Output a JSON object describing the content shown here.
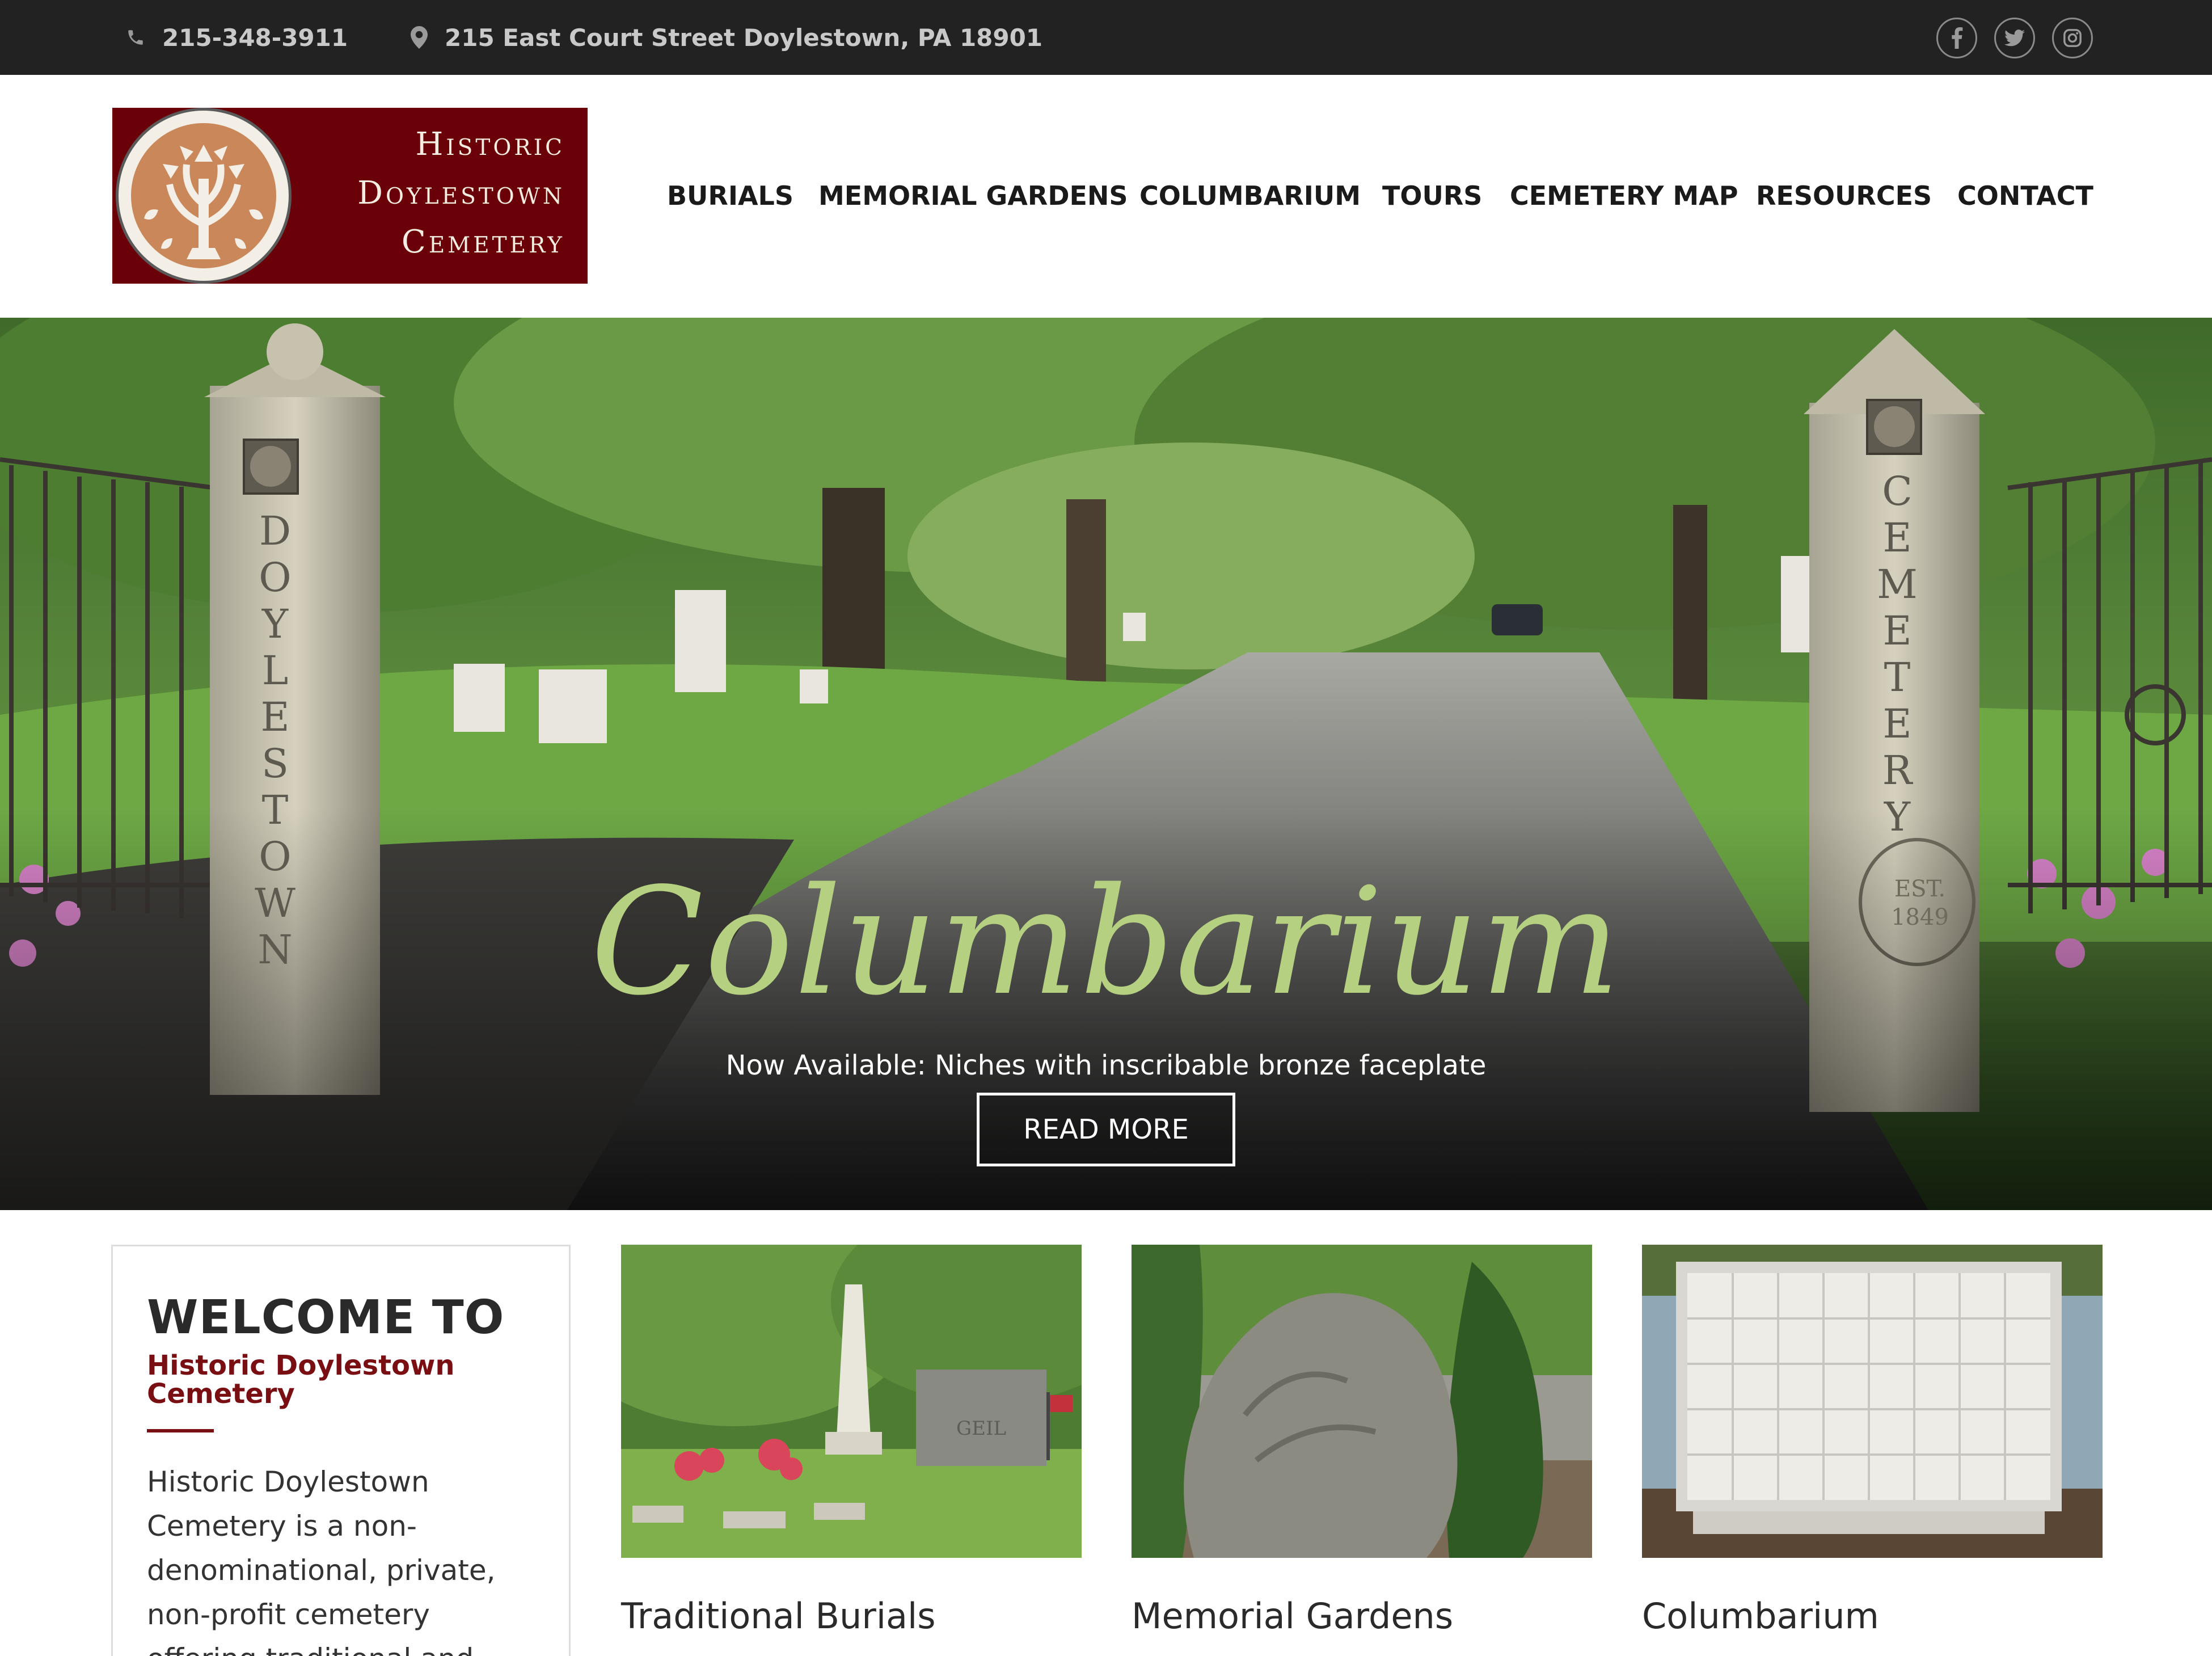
{
  "topbar": {
    "phone": "215-348-3911",
    "address": "215 East Court Street Doylestown, PA 18901",
    "social": [
      {
        "name": "facebook-icon",
        "glyph": "f"
      },
      {
        "name": "twitter-icon",
        "glyph": "t"
      },
      {
        "name": "instagram-icon",
        "glyph": "i"
      }
    ]
  },
  "logo": {
    "line1": "Historic",
    "line2": "Doylestown",
    "line3": "Cemetery",
    "colors": {
      "background": "#6a0008",
      "emblem": "#c9875a"
    }
  },
  "nav": {
    "items": [
      {
        "label": "BURIALS"
      },
      {
        "label": "MEMORIAL GARDENS"
      },
      {
        "label": "COLUMBARIUM"
      },
      {
        "label": "TOURS"
      },
      {
        "label": "CEMETERY MAP"
      },
      {
        "label": "RESOURCES"
      },
      {
        "label": "CONTACT"
      }
    ]
  },
  "hero": {
    "title": "Columbarium",
    "subtitle": "Now Available: Niches with inscribable bronze faceplate",
    "button": "READ MORE",
    "left_pillar_text": "DOYLESTOWN",
    "right_pillar_text": "CEMETERY",
    "est_line1": "EST.",
    "est_line2": "1849",
    "title_color": "#b5d080"
  },
  "welcome": {
    "title": "WELCOME TO",
    "subtitle": "Historic Doylestown Cemetery",
    "body": "Historic Doylestown Cemetery is a non-denominational, private, non-profit cemetery offering traditional and natural burial"
  },
  "cards": [
    {
      "label": "Traditional Burials",
      "headstone_text": "GEIL"
    },
    {
      "label": "Memorial Gardens"
    },
    {
      "label": "Columbarium"
    }
  ]
}
